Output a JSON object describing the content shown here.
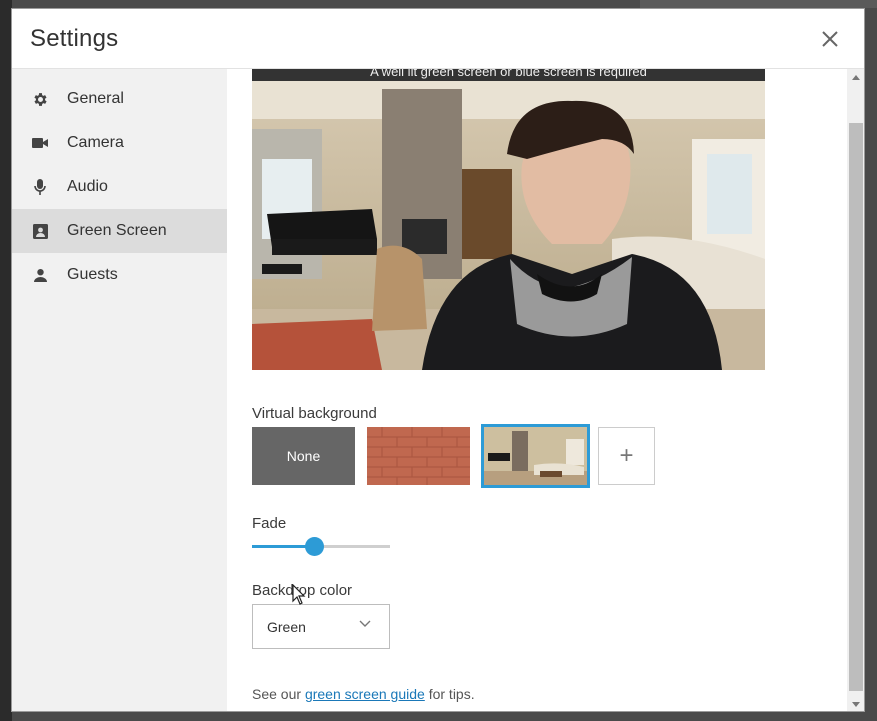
{
  "modal": {
    "title": "Settings"
  },
  "sidebar": {
    "items": [
      {
        "label": "General",
        "icon": "gear-icon"
      },
      {
        "label": "Camera",
        "icon": "camera-icon"
      },
      {
        "label": "Audio",
        "icon": "microphone-icon"
      },
      {
        "label": "Green Screen",
        "icon": "green-screen-icon",
        "active": true
      },
      {
        "label": "Guests",
        "icon": "person-icon"
      }
    ]
  },
  "preview": {
    "caption": "A well lit green screen or blue screen is required"
  },
  "virtual_background": {
    "label": "Virtual background",
    "none_label": "None",
    "add_label": "+",
    "selected_index": 2
  },
  "fade": {
    "label": "Fade",
    "value_fraction": 0.45
  },
  "backdrop": {
    "label": "Backdrop color",
    "selected": "Green"
  },
  "tips": {
    "prefix": "See our ",
    "link": "green screen guide",
    "suffix": " for tips."
  },
  "colors": {
    "accent": "#2d9bd6",
    "sidebar_bg": "#f1f1f1",
    "active_bg": "#dcdcdc"
  }
}
